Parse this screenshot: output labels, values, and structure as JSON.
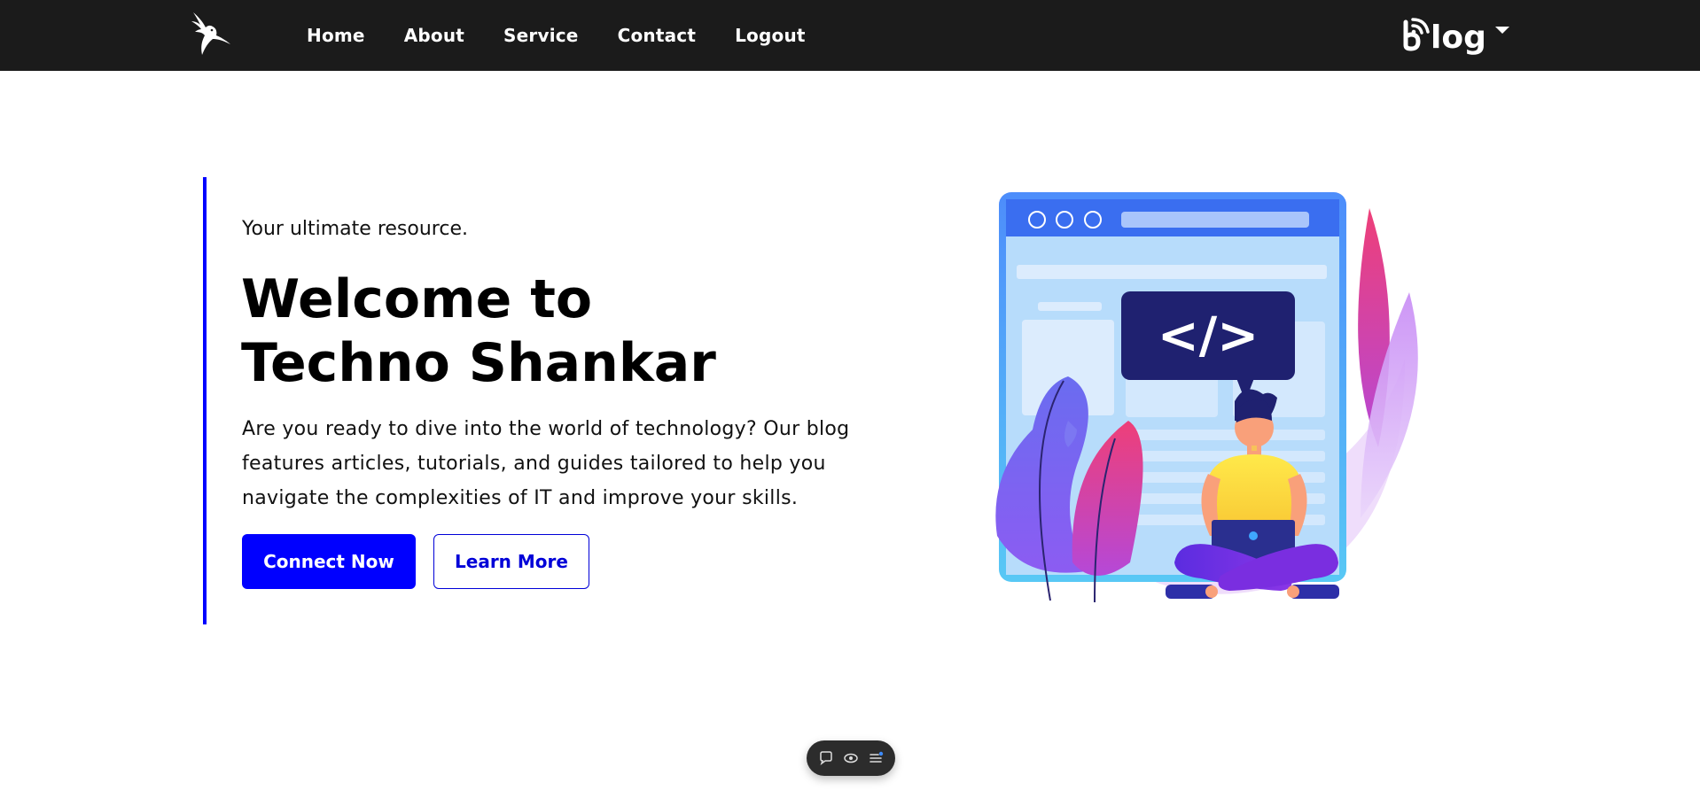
{
  "nav": {
    "logo_icon": "hummingbird-logo",
    "links": [
      "Home",
      "About",
      "Service",
      "Contact",
      "Logout"
    ],
    "brand_text": "log",
    "brand_icon": "b-wifi-icon",
    "brand_caret_icon": "caret-down-icon"
  },
  "hero": {
    "eyebrow": "Your ultimate resource.",
    "title": "Welcome to Techno Shankar",
    "description": "Are you ready to dive into the world of technology? Our blog features articles, tutorials, and guides tailored to help you navigate the complexities of IT and improve your skills.",
    "primary_button": "Connect Now",
    "secondary_button": "Learn More",
    "code_tag": "</>"
  },
  "toolbar": {
    "icons": [
      "comment-icon",
      "eye-icon",
      "list-icon"
    ]
  },
  "colors": {
    "nav_bg": "#1b1b1b",
    "accent": "#0000ff",
    "text": "#000000"
  }
}
